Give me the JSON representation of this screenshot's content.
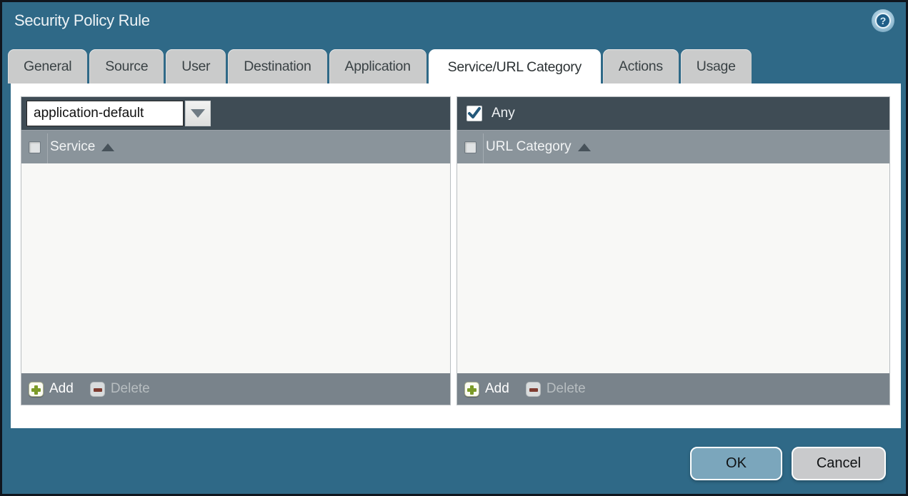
{
  "window": {
    "title": "Security Policy Rule",
    "help_icon": "?"
  },
  "tabs": [
    {
      "label": "General",
      "active": false
    },
    {
      "label": "Source",
      "active": false
    },
    {
      "label": "User",
      "active": false
    },
    {
      "label": "Destination",
      "active": false
    },
    {
      "label": "Application",
      "active": false
    },
    {
      "label": "Service/URL Category",
      "active": true
    },
    {
      "label": "Actions",
      "active": false
    },
    {
      "label": "Usage",
      "active": false
    }
  ],
  "panels": {
    "left": {
      "dropdown_value": "application-default",
      "column_header": "Service",
      "sort_direction": "asc",
      "rows": [],
      "footer": {
        "add_label": "Add",
        "delete_label": "Delete",
        "delete_enabled": false
      }
    },
    "right": {
      "any_label": "Any",
      "any_checked": true,
      "column_header": "URL Category",
      "sort_direction": "asc",
      "rows": [],
      "footer": {
        "add_label": "Add",
        "delete_label": "Delete",
        "delete_enabled": false
      }
    }
  },
  "buttons": {
    "ok": "OK",
    "cancel": "Cancel"
  },
  "colors": {
    "dialog_bg": "#2f6987",
    "outer_border": "#10161e",
    "active_tab_bg": "#ffffff",
    "inactive_tab_bg": "#cacbcb",
    "panel_topbar_bg": "#3f4c55",
    "column_header_bg": "#8a949b",
    "footer_bar_bg": "#79838b",
    "add_plus": "#7c9b28",
    "delete_minus": "#7e3b30",
    "any_checkmark": "#23587a",
    "ok_button_bg": "#7ba6bc",
    "cancel_button_bg": "#c9cacc"
  }
}
